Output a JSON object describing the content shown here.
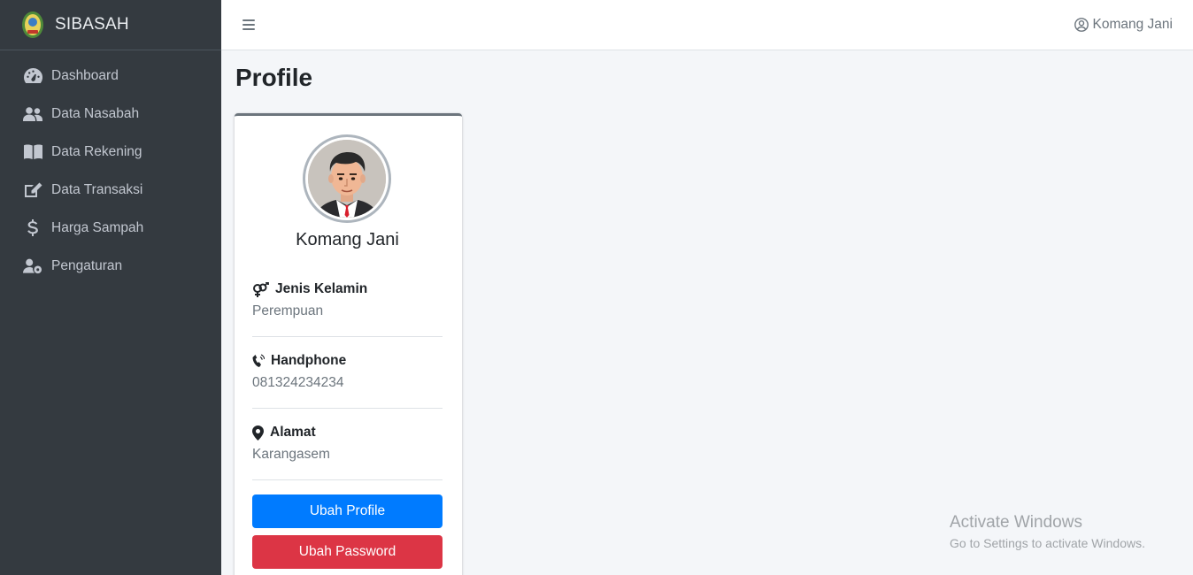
{
  "brand": {
    "name": "SIBASAH",
    "logo_icon": "emblem-logo-icon"
  },
  "sidebar": {
    "items": [
      {
        "label": "Dashboard",
        "icon": "tachometer-icon"
      },
      {
        "label": "Data Nasabah",
        "icon": "users-icon"
      },
      {
        "label": "Data Rekening",
        "icon": "book-icon"
      },
      {
        "label": "Data Transaksi",
        "icon": "edit-icon"
      },
      {
        "label": "Harga Sampah",
        "icon": "dollar-icon"
      },
      {
        "label": "Pengaturan",
        "icon": "user-cog-icon"
      }
    ]
  },
  "topbar": {
    "user_name": "Komang Jani",
    "menu_icon": "hamburger-icon",
    "user_icon": "user-circle-icon"
  },
  "page": {
    "title": "Profile"
  },
  "profile": {
    "name": "Komang Jani",
    "fields": [
      {
        "label": "Jenis Kelamin",
        "value": "Perempuan",
        "icon": "venus-mars-icon"
      },
      {
        "label": "Handphone",
        "value": "081324234234",
        "icon": "phone-volume-icon"
      },
      {
        "label": "Alamat",
        "value": "Karangasem",
        "icon": "map-marker-icon"
      }
    ],
    "buttons": {
      "edit_profile": "Ubah Profile",
      "change_password": "Ubah Password"
    }
  },
  "watermark": {
    "title": "Activate Windows",
    "subtitle": "Go to Settings to activate Windows."
  },
  "colors": {
    "sidebar": "#343a40",
    "primary": "#007bff",
    "danger": "#dc3545",
    "background": "#f4f6f9"
  }
}
